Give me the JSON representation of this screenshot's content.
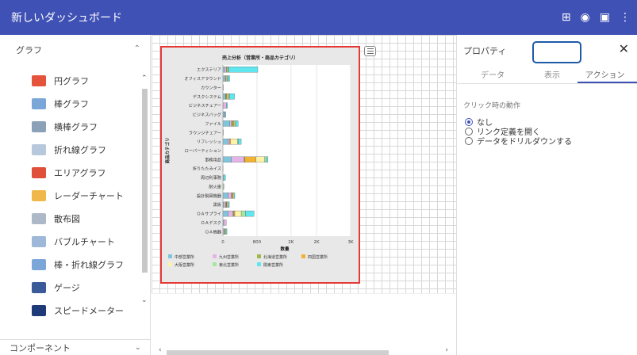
{
  "app": {
    "title": "新しいダッシュボード"
  },
  "toolbar": {
    "icons": [
      {
        "name": "grid-icon",
        "glyph": "⊞"
      },
      {
        "name": "preview-eye-icon",
        "glyph": "◉"
      },
      {
        "name": "save-icon",
        "glyph": "▣"
      },
      {
        "name": "more-vert-icon",
        "glyph": "⋮"
      }
    ]
  },
  "sidebar": {
    "section_title": "グラフ",
    "section_chevron": "⌃",
    "items": [
      {
        "label": "円グラフ",
        "icon": "pie-chart-icon",
        "color": "#e5533d"
      },
      {
        "label": "棒グラフ",
        "icon": "bar-chart-icon",
        "color": "#7aa7d8"
      },
      {
        "label": "横棒グラフ",
        "icon": "horizontal-bar-chart-icon",
        "color": "#8aa1b8"
      },
      {
        "label": "折れ線グラフ",
        "icon": "line-chart-icon",
        "color": "#b8c8dc"
      },
      {
        "label": "エリアグラフ",
        "icon": "area-chart-icon",
        "color": "#e04f3a"
      },
      {
        "label": "レーダーチャート",
        "icon": "radar-chart-icon",
        "color": "#f0b84a"
      },
      {
        "label": "散布図",
        "icon": "scatter-chart-icon",
        "color": "#aeb9c8"
      },
      {
        "label": "バブルチャート",
        "icon": "bubble-chart-icon",
        "color": "#9db8d8"
      },
      {
        "label": "棒・折れ線グラフ",
        "icon": "bar-line-chart-icon",
        "color": "#7aa7d8"
      },
      {
        "label": "ゲージ",
        "icon": "gauge-icon",
        "color": "#3a5a9a"
      },
      {
        "label": "スピードメーター",
        "icon": "speedometer-icon",
        "color": "#1f3a78"
      }
    ],
    "bottom_section": "コンポーネント",
    "bottom_chevron": "⌄"
  },
  "widget": {
    "chart_data": {
      "type": "bar",
      "orientation": "horizontal",
      "stacked": true,
      "title": "売上分析（営業所・商品カテゴリ）",
      "xlabel": "数量",
      "ylabel": "商品カテゴリ",
      "xlim": [
        0,
        3000
      ],
      "xticks": [
        "0",
        "800",
        "2K",
        "2K",
        "3K"
      ],
      "xtick_values": [
        0,
        800,
        1600,
        2200,
        3000
      ],
      "categories": [
        "エクステリア",
        "オフィスアラウンド",
        "カウンター",
        "デスクシステム",
        "ビジネスチェアー",
        "ビジネスバッグ",
        "ファイル",
        "ラウンジチェアー",
        "リフレッシュ",
        "ローパーティション",
        "事務用品",
        "折りたたみイス",
        "周辺利事務",
        "耐火庫",
        "設計製図機器",
        "黒板",
        "ＯＡサプライ",
        "ＯＡデスク",
        "ＯＡ機器"
      ],
      "series": [
        {
          "name": "中部営業所",
          "color": "#7fc6dc",
          "values": [
            40,
            40,
            5,
            60,
            5,
            30,
            160,
            5,
            120,
            0,
            200,
            5,
            20,
            5,
            120,
            20,
            120,
            20,
            5
          ]
        },
        {
          "name": "九州営業所",
          "color": "#e4b4e6",
          "values": [
            40,
            20,
            5,
            5,
            80,
            20,
            40,
            5,
            40,
            0,
            300,
            0,
            0,
            0,
            80,
            40,
            120,
            60,
            30
          ]
        },
        {
          "name": "北海道営業所",
          "color": "#9cb94a",
          "values": [
            20,
            20,
            0,
            20,
            0,
            0,
            40,
            0,
            0,
            0,
            20,
            0,
            0,
            0,
            20,
            20,
            20,
            0,
            20
          ]
        },
        {
          "name": "四国営業所",
          "color": "#f4b233",
          "values": [
            0,
            0,
            0,
            30,
            0,
            0,
            20,
            0,
            20,
            0,
            260,
            0,
            0,
            0,
            20,
            10,
            20,
            0,
            0
          ]
        },
        {
          "name": "大阪営業所",
          "color": "#fff1a8",
          "values": [
            20,
            20,
            0,
            20,
            0,
            0,
            20,
            0,
            160,
            0,
            200,
            0,
            0,
            0,
            20,
            20,
            150,
            0,
            0
          ]
        },
        {
          "name": "東北営業所",
          "color": "#a4e8a0",
          "values": [
            20,
            20,
            0,
            20,
            0,
            0,
            20,
            0,
            20,
            0,
            40,
            0,
            0,
            20,
            0,
            20,
            100,
            0,
            20
          ]
        },
        {
          "name": "関東営業所",
          "color": "#5fe6ee",
          "values": [
            680,
            40,
            0,
            120,
            20,
            20,
            60,
            0,
            70,
            0,
            40,
            0,
            40,
            0,
            20,
            20,
            200,
            0,
            20
          ]
        }
      ],
      "legend_position": "bottom",
      "grid": true
    }
  },
  "properties": {
    "title": "プロパティ",
    "close": "✕",
    "tabs": [
      "データ",
      "表示",
      "アクション"
    ],
    "active_tab": 2,
    "section_label": "クリック時の動作",
    "options": [
      {
        "label": "なし",
        "selected": true
      },
      {
        "label": "リンク定義を開く",
        "selected": false
      },
      {
        "label": "データをドリルダウンする",
        "selected": false
      }
    ]
  },
  "scroll": {
    "left": "‹",
    "right": "›",
    "up": "⌃",
    "down": "⌄"
  }
}
